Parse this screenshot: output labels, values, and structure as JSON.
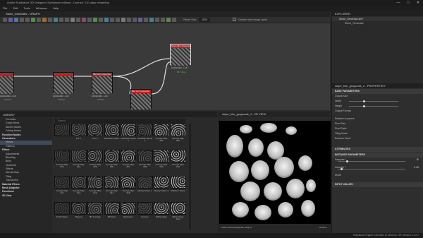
{
  "window": {
    "title": "Adobe Substance 3D Designer (Substance edition) - License: 110 days remaining",
    "controls": [
      "—",
      "□",
      "✕"
    ]
  },
  "menu": [
    "File",
    "Edit",
    "Tools",
    "Windows",
    "Help"
  ],
  "graph": {
    "tab_label": "Stone_Generator - GRAPH",
    "parent_size_label": "Parent Size:",
    "parent_size_value": "1024",
    "display_image_label": "Disable node image cache",
    "nodes": [
      {
        "title": "",
        "res": "1024x1024 - L16",
        "time": "0.21ms"
      },
      {
        "title": "",
        "res": "1024x1024 - L16",
        "time": "0.03ms"
      },
      {
        "title": "Blur HQ Grayscale",
        "res": "1024x1024 - L16",
        "time": "0.02ms"
      },
      {
        "title": "Blur HQ Grayscale",
        "res": "1024x1024 - L16",
        "time": "1.59ms"
      },
      {
        "title": "Slope Blur Grayscale",
        "res": "1024x1024 - L16",
        "time": "15.7 1ms"
      }
    ]
  },
  "explorer": {
    "title": "EXPLORER",
    "file": "Stone_Generator.sbs*",
    "graph": "Stone_Generator"
  },
  "properties": {
    "title": "slope_blur_grayscale_2 - PROPERTIES",
    "sections": {
      "base": "BASE PARAMETERS",
      "attributes": "ATTRIBUTES",
      "instance": "INSTANCE PARAMETERS",
      "input": "INPUT VALUES"
    },
    "rows": {
      "output_size": "Output Size",
      "width": "Width",
      "height": "Height",
      "relative_to_parent": "Relative to parent",
      "output_format": "Output Format",
      "pixel_size": "Pixel Size",
      "pixel_ratio": "Pixel Ratio",
      "tiling_mode": "Tiling Mode",
      "random_seed": "Random Seed",
      "samples": "Samples *",
      "samples_value": "16",
      "intensity": "Intensity *",
      "intensity_value": "0.25",
      "mode": "Mode"
    }
  },
  "library": {
    "title": "LIBRARY",
    "search_placeholder": "Search",
    "tree": [
      {
        "label": "Favorites",
        "h": false
      },
      {
        "label": "Graph Items",
        "h": false
      },
      {
        "label": "Atomic Nodes",
        "h": false
      },
      {
        "label": "FxMap Nodes",
        "h": false
      },
      {
        "label": "Function Nodes",
        "h": true
      },
      {
        "label": "Generators",
        "h": true
      },
      {
        "label": "Noises",
        "h": false,
        "sel": true
      },
      {
        "label": "Patterns",
        "h": false
      },
      {
        "label": "Filters",
        "h": true
      },
      {
        "label": "Adjustments",
        "h": false
      },
      {
        "label": "Blending",
        "h": false
      },
      {
        "label": "Blurs",
        "h": false
      },
      {
        "label": "Channels",
        "h": false
      },
      {
        "label": "Effects",
        "h": false
      },
      {
        "label": "Normal Map",
        "h": false
      },
      {
        "label": "Tiling",
        "h": false
      },
      {
        "label": "Transforms",
        "h": false
      },
      {
        "label": "Material Filters",
        "h": true
      },
      {
        "label": "Mesh Adaptive",
        "h": true
      },
      {
        "label": "Functions",
        "h": true
      },
      {
        "label": "3D View",
        "h": true
      }
    ],
    "tiles": [
      "",
      "Fur 1",
      "Fur 2",
      "Gaussian Noise",
      "Gaussian Spots 1",
      "Gaussian Spots 2",
      "Grunge Map 001",
      "Grunge Map 002",
      "Grunge Map 003",
      "Grunge Map 004",
      "Grunge Map 005",
      "Grunge Map 006",
      "Grunge Map 007",
      "Grunge Map 008",
      "Grunge Map 009",
      "Grunge Map 010",
      "Grunge Map 011",
      "Grunge Map 012",
      "Grunge Map 013",
      "Grunge Map 014",
      "Grunge Map 015",
      "Messy Fibers 1",
      "Messy Fibers 2",
      "Moisture Noise",
      "Perlin Noise",
      "Plasma",
      "BF Crystals",
      "BF Dots",
      "Starburst 1",
      "Voronoi",
      "White Noise",
      "White Noise Fast"
    ]
  },
  "view2d": {
    "title": "slope_blur_grayscale_2 - 2D VIEW",
    "info": "1024 x 1024 (Grayscale, 16bpc)",
    "zoom": "46.22%"
  },
  "statusbar": {
    "text": "Substance Engine: Direct3D 11  Memory: 3%  Version: 11.2.2"
  },
  "colors": {
    "node_header": "#b32424",
    "accent_green": "#6fcf40",
    "selection": "#3c4a5a"
  }
}
